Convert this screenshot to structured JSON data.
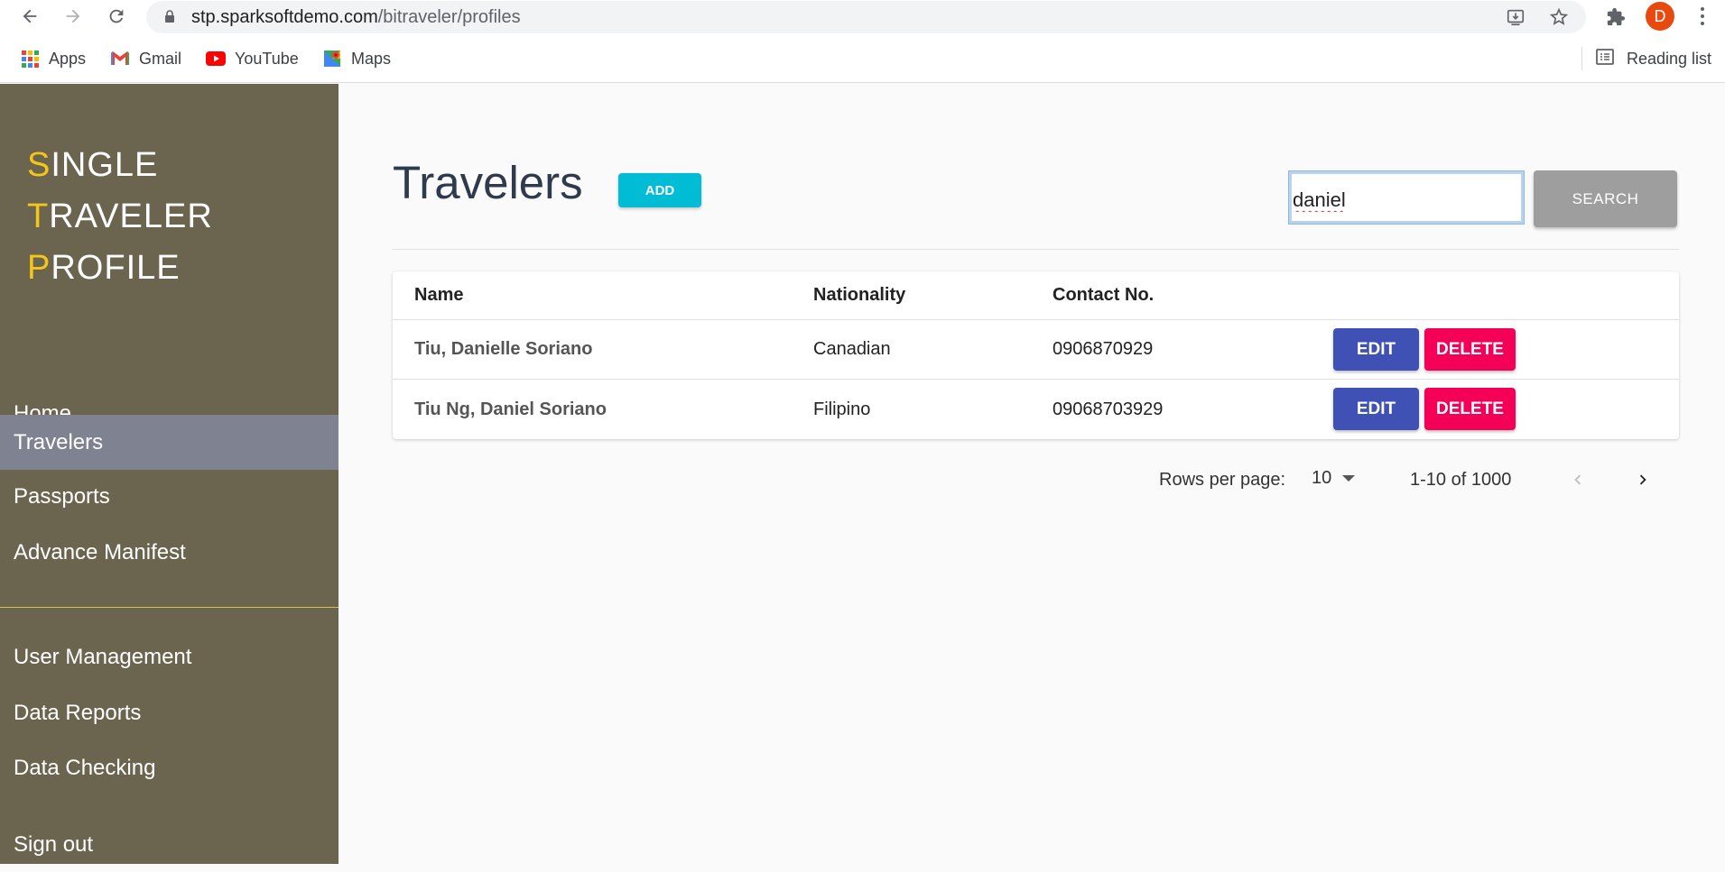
{
  "browser": {
    "url_host": "stp.sparksoftdemo.com",
    "url_path": "/bitraveler/profiles",
    "avatar_letter": "D",
    "bookmarks": [
      {
        "label": "Apps",
        "icon": "apps-grid-icon"
      },
      {
        "label": "Gmail",
        "icon": "gmail-icon"
      },
      {
        "label": "YouTube",
        "icon": "youtube-icon"
      },
      {
        "label": "Maps",
        "icon": "maps-icon"
      }
    ],
    "reading_list": "Reading list"
  },
  "sidebar": {
    "brand": [
      {
        "cap": "S",
        "rest": "INGLE"
      },
      {
        "cap": "T",
        "rest": "RAVELER"
      },
      {
        "cap": "P",
        "rest": "ROFILE"
      }
    ],
    "items": [
      {
        "label": "Home"
      },
      {
        "label": "Travelers",
        "active": true
      },
      {
        "label": "Passports"
      },
      {
        "label": "Advance Manifest"
      },
      {
        "label": "User Management"
      },
      {
        "label": "Data Reports"
      },
      {
        "label": "Data Checking"
      },
      {
        "label": "Sign out"
      }
    ]
  },
  "main": {
    "title": "Travelers",
    "add_label": "ADD",
    "search_value": "daniel",
    "search_label": "SEARCH",
    "table": {
      "headers": {
        "name": "Name",
        "nationality": "Nationality",
        "contact": "Contact No."
      },
      "rows": [
        {
          "name": "Tiu, Danielle Soriano",
          "nationality": "Canadian",
          "contact": "0906870929",
          "edit": "EDIT",
          "delete": "DELETE"
        },
        {
          "name": "Tiu Ng, Daniel Soriano",
          "nationality": "Filipino",
          "contact": "09068703929",
          "edit": "EDIT",
          "delete": "DELETE"
        }
      ]
    },
    "pagination": {
      "rows_per_page_label": "Rows per page:",
      "rows_per_page_value": "10",
      "range": "1-10 of 1000"
    }
  },
  "colors": {
    "sidebar_bg": "#6b6550",
    "sidebar_active": "#7f8291",
    "brand_accent": "#f5c518",
    "add_button": "#00bcd4",
    "edit_button": "#3f51b5",
    "delete_button": "#f50057",
    "search_button": "#9e9e9e"
  }
}
